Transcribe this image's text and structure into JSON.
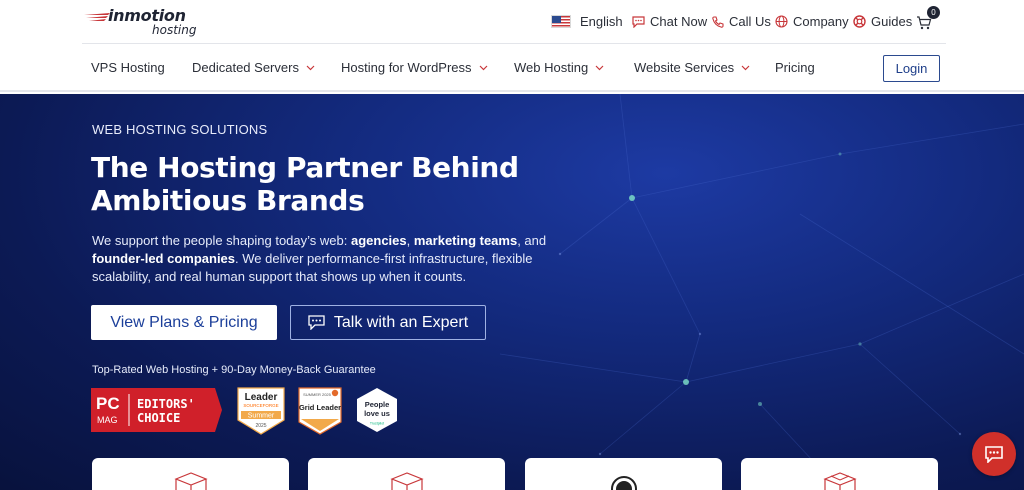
{
  "brand": {
    "word": "inmotion",
    "sub": "hosting"
  },
  "utility": {
    "language": "English",
    "chat": "Chat Now",
    "call": "Call Us",
    "company": "Company",
    "guides": "Guides",
    "cart_count": "0"
  },
  "nav": {
    "items": [
      {
        "label": "VPS Hosting"
      },
      {
        "label": "Dedicated Servers"
      },
      {
        "label": "Hosting for WordPress"
      },
      {
        "label": "Web Hosting"
      },
      {
        "label": "Website Services"
      },
      {
        "label": "Pricing"
      }
    ],
    "login": "Login"
  },
  "hero": {
    "eyebrow": "WEB HOSTING SOLUTIONS",
    "headline": "The Hosting Partner Behind Ambitious Brands",
    "lede": {
      "p1": "We support the people shaping today’s web: ",
      "b1": "agencies",
      "p2": ", ",
      "b2": "marketing teams",
      "p3": ", and ",
      "b3": "founder-led companies",
      "p4": ". We deliver performance-first infrastructure, flexible scalability, and real human support that shows up when it counts."
    },
    "primary_cta": "View Plans & Pricing",
    "secondary_cta": "Talk with an Expert",
    "guarantee": "Top-Rated Web Hosting + 90-Day Money-Back Guarantee"
  },
  "badges": {
    "pcmag": {
      "pc": "PC",
      "mag": "MAG",
      "line1": "EDITORS'",
      "line2": "CHOICE"
    },
    "sourceforge": {
      "title": "Leader",
      "sub": "SOURCEFORGE",
      "season": "Summer",
      "year": "2025"
    },
    "g2": {
      "top": "SUMMER 2025",
      "title": "Grid Leader"
    },
    "trustpilot": {
      "line1": "People",
      "line2": "love us",
      "brand": "Trustpilot"
    }
  },
  "colors": {
    "hero_dark": "#0c1a55",
    "hero_mid": "#1d3aa3",
    "accent_red": "#d0302a",
    "link_blue": "#1c3f9a",
    "chevron_red": "#c8373a"
  }
}
